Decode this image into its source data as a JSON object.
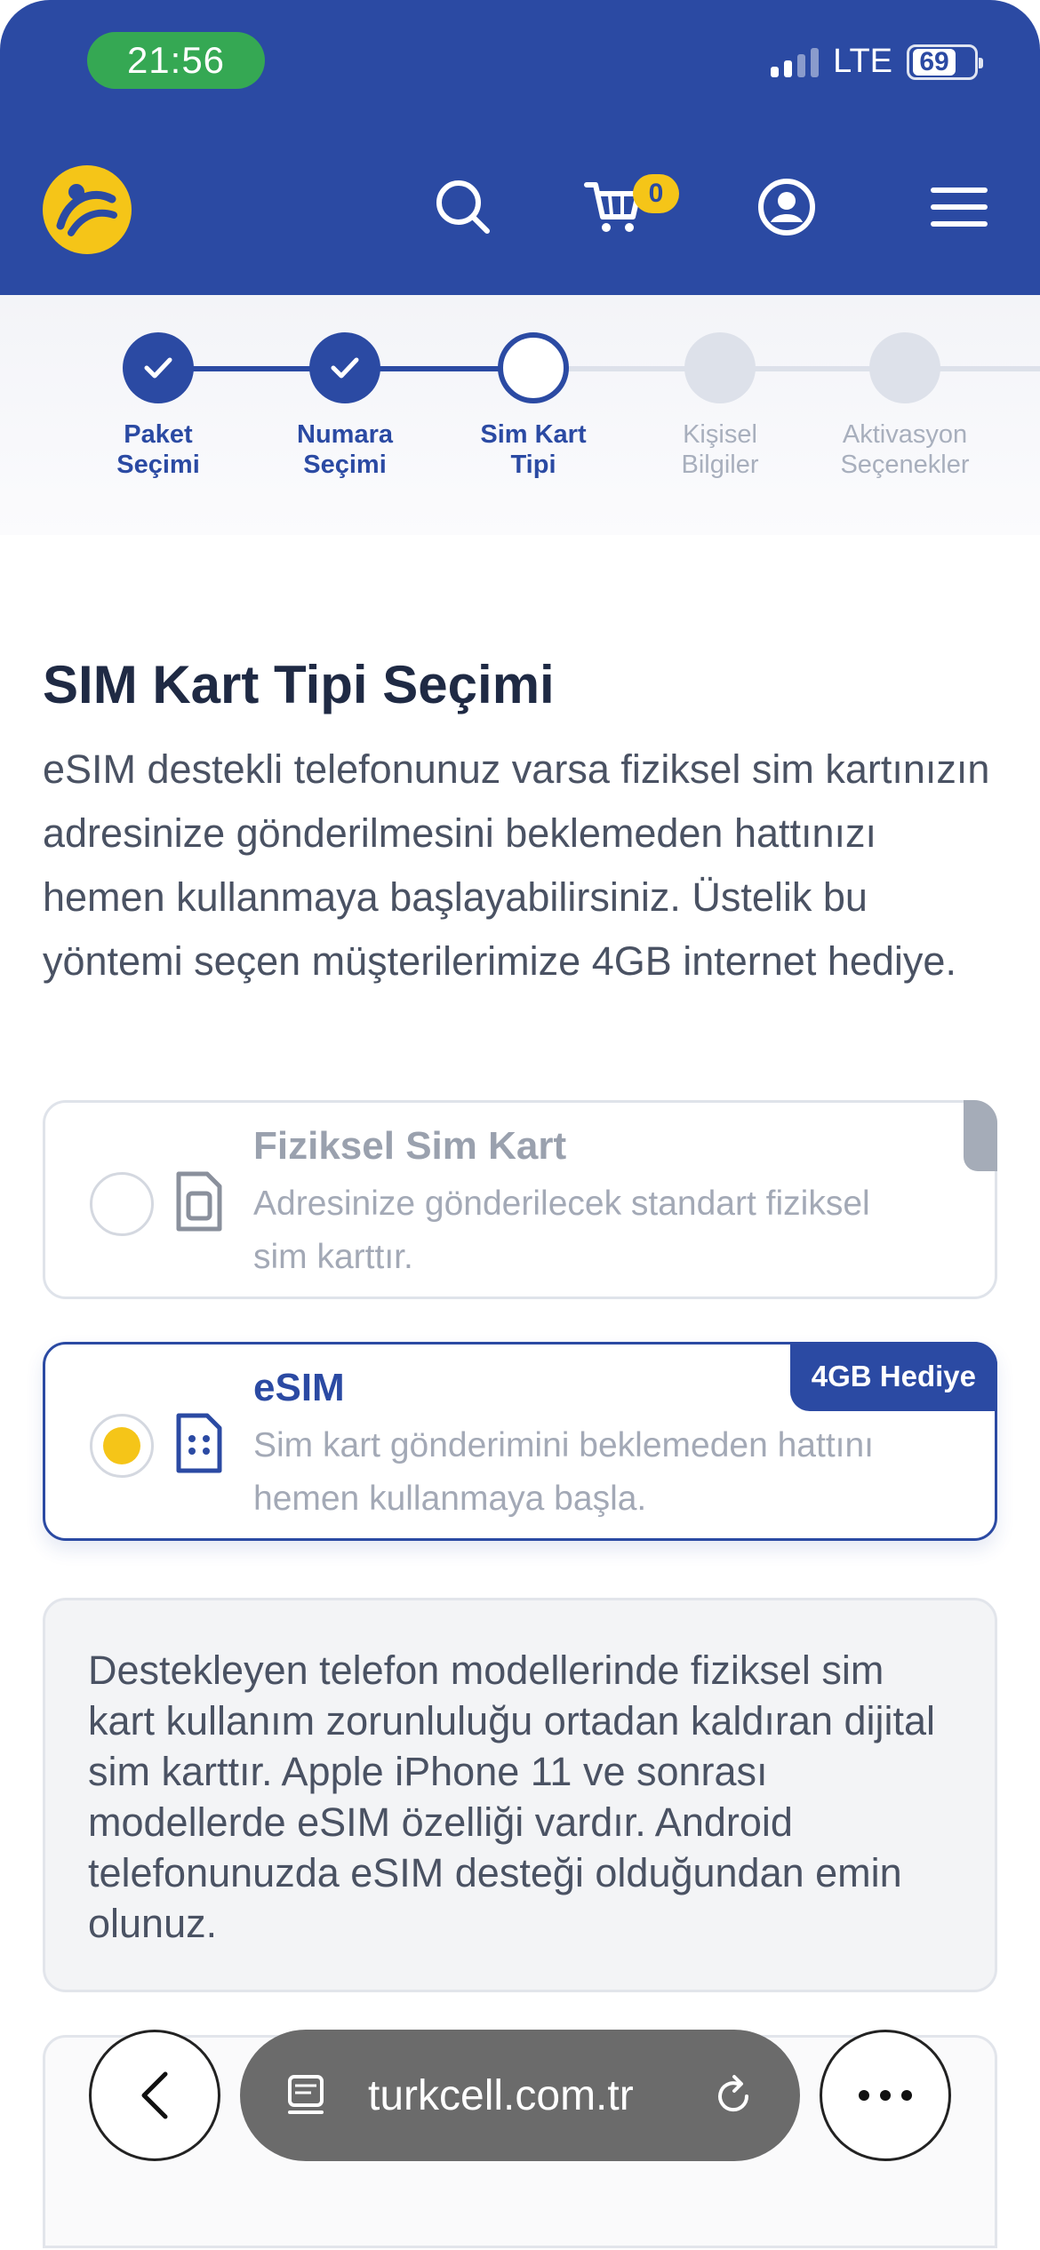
{
  "status_bar": {
    "time": "21:56",
    "network": "LTE",
    "battery": "69"
  },
  "header": {
    "cart_count": "0"
  },
  "stepper": {
    "steps": [
      {
        "label_line1": "Paket",
        "label_line2": "Seçimi",
        "state": "done"
      },
      {
        "label_line1": "Numara",
        "label_line2": "Seçimi",
        "state": "done"
      },
      {
        "label_line1": "Sim Kart",
        "label_line2": "Tipi",
        "state": "current"
      },
      {
        "label_line1": "Kişisel",
        "label_line2": "Bilgiler",
        "state": "todo"
      },
      {
        "label_line1": "Aktivasyon",
        "label_line2": "Seçenekler",
        "state": "todo"
      }
    ]
  },
  "main": {
    "title": "SIM Kart Tipi Seçimi",
    "description": "eSIM destekli telefonunuz varsa fiziksel sim kartınızın adresinize gönderilmesini beklemeden hattınızı hemen kullanmaya başlayabilirsiniz. Üstelik bu yöntemi seçen müşterilerimize 4GB internet hediye."
  },
  "options": {
    "physical": {
      "title": "Fiziksel Sim Kart",
      "subtitle": "Adresinize gönderilecek standart fiziksel sim karttır.",
      "selected": false
    },
    "esim": {
      "title": "eSIM",
      "subtitle": "Sim kart gönderimini beklemeden hattını hemen kullanmaya başla.",
      "badge": "4GB Hediye",
      "selected": true
    }
  },
  "info_box": {
    "text": "Destekleyen telefon modellerinde fiziksel sim kart kullanım zorunluluğu ortadan kaldıran dijital sim karttır. Apple iPhone 11 ve sonrası modellerde eSIM özelliği vardır. Android telefonunuzda eSIM desteği olduğundan emin olunuz."
  },
  "browser_bar": {
    "url": "turkcell.com.tr"
  },
  "colors": {
    "brand_blue": "#2b4aa3",
    "brand_yellow": "#f5c518",
    "status_green": "#35a853"
  }
}
